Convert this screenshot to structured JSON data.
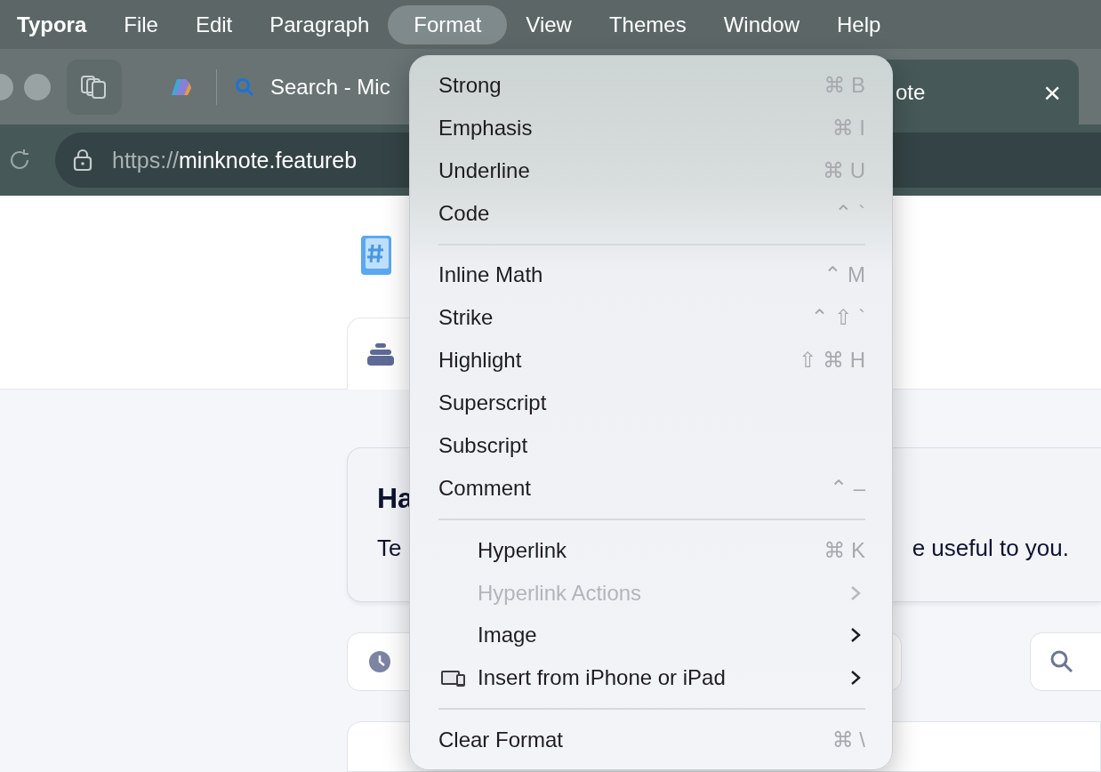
{
  "menu_bar": [
    {
      "label": "Typora",
      "selected": false,
      "app": true
    },
    {
      "label": "File",
      "selected": false,
      "app": false
    },
    {
      "label": "Edit",
      "selected": false,
      "app": false
    },
    {
      "label": "Paragraph",
      "selected": false,
      "app": false
    },
    {
      "label": "Format",
      "selected": true,
      "app": false
    },
    {
      "label": "View",
      "selected": false,
      "app": false
    },
    {
      "label": "Themes",
      "selected": false,
      "app": false
    },
    {
      "label": "Window",
      "selected": false,
      "app": false
    },
    {
      "label": "Help",
      "selected": false,
      "app": false
    }
  ],
  "browser": {
    "tabs": [
      {
        "title": "Search - Mic",
        "selected": false
      },
      {
        "title": "ote",
        "selected": true,
        "close": "×"
      }
    ],
    "url": {
      "scheme": "https://",
      "rest": "minknote.featureb"
    }
  },
  "page": {
    "heading": "Ha",
    "text_start": "Te",
    "text_end": "e useful to you."
  },
  "format_menu": [
    {
      "kind": "item",
      "label": "Strong",
      "shortcut": "⌘ B",
      "disabled": false,
      "indented": false,
      "submenu": false,
      "device_icon": false
    },
    {
      "kind": "item",
      "label": "Emphasis",
      "shortcut": "⌘ I",
      "disabled": false,
      "indented": false,
      "submenu": false,
      "device_icon": false
    },
    {
      "kind": "item",
      "label": "Underline",
      "shortcut": "⌘ U",
      "disabled": false,
      "indented": false,
      "submenu": false,
      "device_icon": false
    },
    {
      "kind": "item",
      "label": "Code",
      "shortcut": "⌃ `",
      "disabled": false,
      "indented": false,
      "submenu": false,
      "device_icon": false
    },
    {
      "kind": "separator"
    },
    {
      "kind": "item",
      "label": "Inline Math",
      "shortcut": "⌃ M",
      "disabled": false,
      "indented": false,
      "submenu": false,
      "device_icon": false
    },
    {
      "kind": "item",
      "label": "Strike",
      "shortcut": "⌃ ⇧ `",
      "disabled": false,
      "indented": false,
      "submenu": false,
      "device_icon": false
    },
    {
      "kind": "item",
      "label": "Highlight",
      "shortcut": "⇧ ⌘ H",
      "disabled": false,
      "indented": false,
      "submenu": false,
      "device_icon": false
    },
    {
      "kind": "item",
      "label": "Superscript",
      "disabled": false,
      "indented": false,
      "submenu": false,
      "device_icon": false
    },
    {
      "kind": "item",
      "label": "Subscript",
      "disabled": false,
      "indented": false,
      "submenu": false,
      "device_icon": false
    },
    {
      "kind": "item",
      "label": "Comment",
      "shortcut": "⌃ –",
      "disabled": false,
      "indented": false,
      "submenu": false,
      "device_icon": false
    },
    {
      "kind": "separator"
    },
    {
      "kind": "item",
      "label": "Hyperlink",
      "shortcut": "⌘ K",
      "disabled": false,
      "indented": true,
      "submenu": false,
      "device_icon": false
    },
    {
      "kind": "item",
      "label": "Hyperlink Actions",
      "disabled": true,
      "indented": true,
      "submenu": true,
      "device_icon": false
    },
    {
      "kind": "item",
      "label": "Image",
      "disabled": false,
      "indented": true,
      "submenu": true,
      "device_icon": false
    },
    {
      "kind": "item",
      "label": "Insert from iPhone or iPad",
      "disabled": false,
      "indented": true,
      "submenu": true,
      "device_icon": true
    },
    {
      "kind": "separator"
    },
    {
      "kind": "item",
      "label": "Clear Format",
      "shortcut": "⌘ \\",
      "disabled": false,
      "indented": false,
      "submenu": false,
      "device_icon": false
    }
  ]
}
